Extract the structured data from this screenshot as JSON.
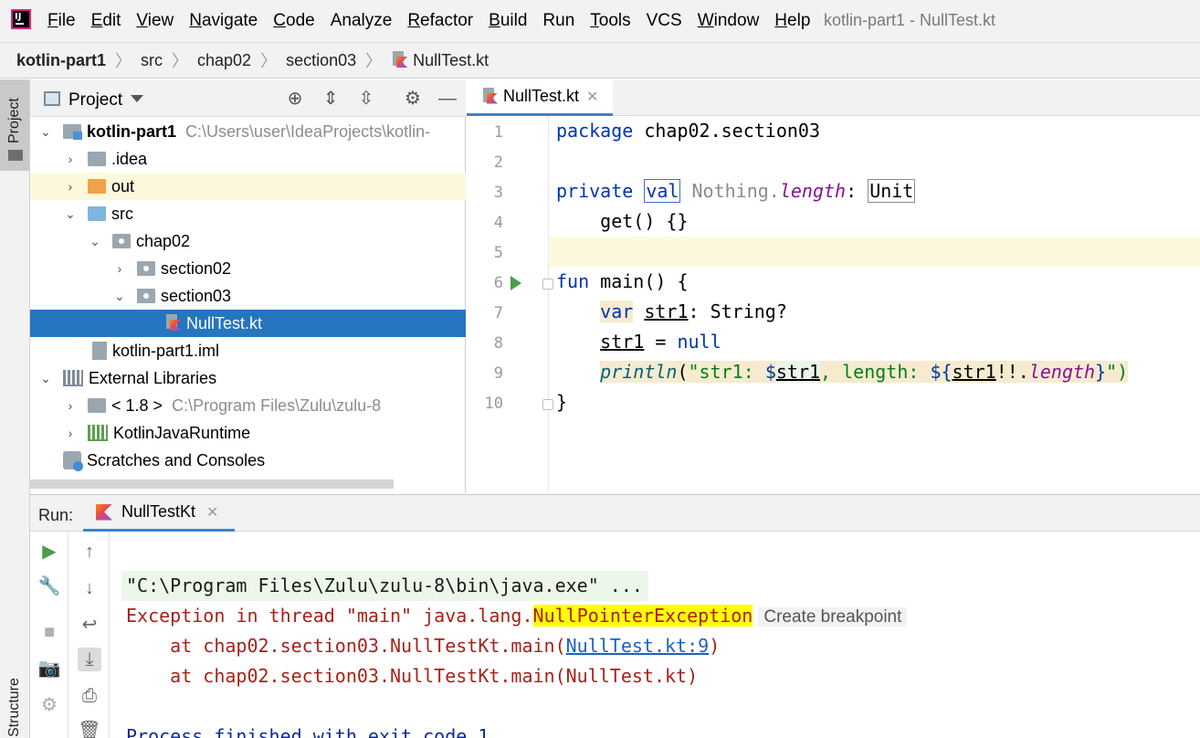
{
  "menubar": {
    "items": [
      {
        "label": "File",
        "mnemonic": "F",
        "rest": "ile"
      },
      {
        "label": "Edit",
        "mnemonic": "E",
        "rest": "dit"
      },
      {
        "label": "View",
        "mnemonic": "V",
        "rest": "iew"
      },
      {
        "label": "Navigate",
        "mnemonic": "N",
        "rest": "avigate"
      },
      {
        "label": "Code",
        "mnemonic": "C",
        "rest": "ode"
      },
      {
        "label": "Analyze",
        "mnemonic": "",
        "rest": "Analyze"
      },
      {
        "label": "Refactor",
        "mnemonic": "R",
        "rest": "efactor"
      },
      {
        "label": "Build",
        "mnemonic": "B",
        "rest": "uild"
      },
      {
        "label": "Run",
        "mnemonic": "",
        "rest": "Run"
      },
      {
        "label": "Tools",
        "mnemonic": "T",
        "rest": "ools"
      },
      {
        "label": "VCS",
        "mnemonic": "",
        "rest": "VCS"
      },
      {
        "label": "Window",
        "mnemonic": "W",
        "rest": "indow"
      },
      {
        "label": "Help",
        "mnemonic": "H",
        "rest": "elp"
      }
    ],
    "window_title": "kotlin-part1 - NullTest.kt"
  },
  "breadcrumb": [
    "kotlin-part1",
    "src",
    "chap02",
    "section03",
    "NullTest.kt"
  ],
  "left_stripe": {
    "project": "Project",
    "structure": "Structure"
  },
  "project_panel": {
    "title": "Project",
    "tree": [
      {
        "label": "kotlin-part1",
        "path": "C:\\Users\\user\\IdeaProjects\\kotlin-"
      },
      {
        "label": ".idea"
      },
      {
        "label": "out"
      },
      {
        "label": "src"
      },
      {
        "label": "chap02"
      },
      {
        "label": "section02"
      },
      {
        "label": "section03"
      },
      {
        "label": "NullTest.kt"
      },
      {
        "label": "kotlin-part1.iml"
      },
      {
        "label": "External Libraries"
      },
      {
        "label": "< 1.8 >",
        "path": "C:\\Program Files\\Zulu\\zulu-8"
      },
      {
        "label": "KotlinJavaRuntime"
      },
      {
        "label": "Scratches and Consoles"
      }
    ]
  },
  "editor": {
    "tab": "NullTest.kt",
    "line_numbers": [
      "1",
      "2",
      "3",
      "4",
      "5",
      "6",
      "7",
      "8",
      "9",
      "10"
    ],
    "code": {
      "l1_kw": "package",
      "l1_rest": " chap02.section03",
      "l3_private": "private",
      "l3_val": "val",
      "l3_nothing": " Nothing.",
      "l3_length": "length",
      "l3_colon": ": ",
      "l3_unit": "Unit",
      "l4": "    get() {}",
      "l6_fun": "fun",
      "l6_rest": " main() {",
      "l7_var": "var",
      "l7_str1": "str1",
      "l7_rest": ": String?",
      "l8_str1": "str1",
      "l8_eq": " = ",
      "l8_null": "null",
      "l9_println": "println",
      "l9_open": "(",
      "l9_s1": "\"str1: ",
      "l9_dollar": "$",
      "l9_var1": "str1",
      "l9_s2": ", length: ",
      "l9_tmpl": "${",
      "l9_var2": "str1",
      "l9_bang": "!!.",
      "l9_length": "length",
      "l9_close": "}",
      "l9_end": "\")",
      "l10": "}"
    }
  },
  "run_panel": {
    "label": "Run:",
    "tab": "NullTestKt",
    "console": {
      "cmd": "\"C:\\Program Files\\Zulu\\zulu-8\\bin\\java.exe\" ...",
      "exc_prefix": "Exception in thread \"main\" java.lang.",
      "exc_name": "NullPointerException",
      "create_bp": "Create breakpoint",
      "at1_prefix": "    at chap02.section03.NullTestKt.main(",
      "at1_link": "NullTest.kt:9",
      "at1_suffix": ")",
      "at2": "    at chap02.section03.NullTestKt.main(NullTest.kt)",
      "finished": "Process finished with exit code 1"
    }
  }
}
